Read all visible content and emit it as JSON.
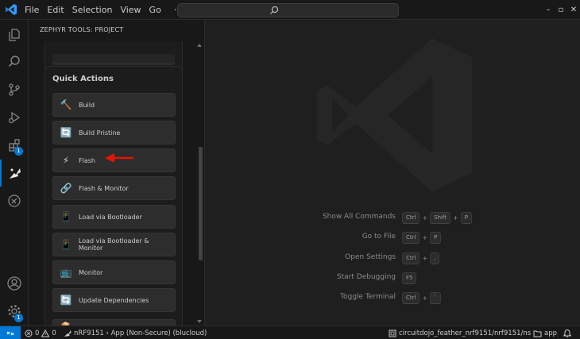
{
  "menu": {
    "items": [
      "File",
      "Edit",
      "Selection",
      "View",
      "Go"
    ],
    "more": "···"
  },
  "window_controls": {
    "minimize": "–",
    "maximize": "▫",
    "close": "✕"
  },
  "activity_bar": {
    "icons": [
      "files-icon",
      "search-icon",
      "source-control-icon",
      "run-debug-icon",
      "extensions-icon",
      "zephyr-tools-icon",
      "device-icon",
      "account-icon",
      "gear-icon"
    ],
    "extensions_badge": "1",
    "settings_badge": "1",
    "active": "zephyr-tools-icon"
  },
  "sidebar": {
    "title": "ZEPHYR TOOLS: PROJECT",
    "quick_actions": {
      "heading": "Quick Actions",
      "items": [
        {
          "label": "Build",
          "icon": "🔨"
        },
        {
          "label": "Build Pristine",
          "icon": "🔄"
        },
        {
          "label": "Flash",
          "icon": "⚡"
        },
        {
          "label": "Flash & Monitor",
          "icon": "🔗"
        },
        {
          "label": "Load via Bootloader",
          "icon": "📱"
        },
        {
          "label": "Load via Bootloader & Monitor",
          "icon": "📱"
        },
        {
          "label": "Monitor",
          "icon": "📺"
        },
        {
          "label": "Update Dependencies",
          "icon": "🔄"
        }
      ]
    }
  },
  "editor": {
    "shortcuts": [
      {
        "label": "Show All Commands",
        "keys": [
          "Ctrl",
          "Shift",
          "P"
        ]
      },
      {
        "label": "Go to File",
        "keys": [
          "Ctrl",
          "P"
        ]
      },
      {
        "label": "Open Settings",
        "keys": [
          "Ctrl",
          ","
        ]
      },
      {
        "label": "Start Debugging",
        "keys": [
          "F5"
        ]
      },
      {
        "label": "Toggle Terminal",
        "keys": [
          "Ctrl",
          "`"
        ]
      }
    ]
  },
  "status_bar": {
    "errors": "0",
    "warnings": "0",
    "project": "nRF9151 › App (Non-Secure) (blucloud)",
    "board": "circuitdojo_feather_nrf9151/nrf9151/ns",
    "folder": "app"
  },
  "colors": {
    "accent": "#0078d4",
    "annotation": "#e51400"
  }
}
